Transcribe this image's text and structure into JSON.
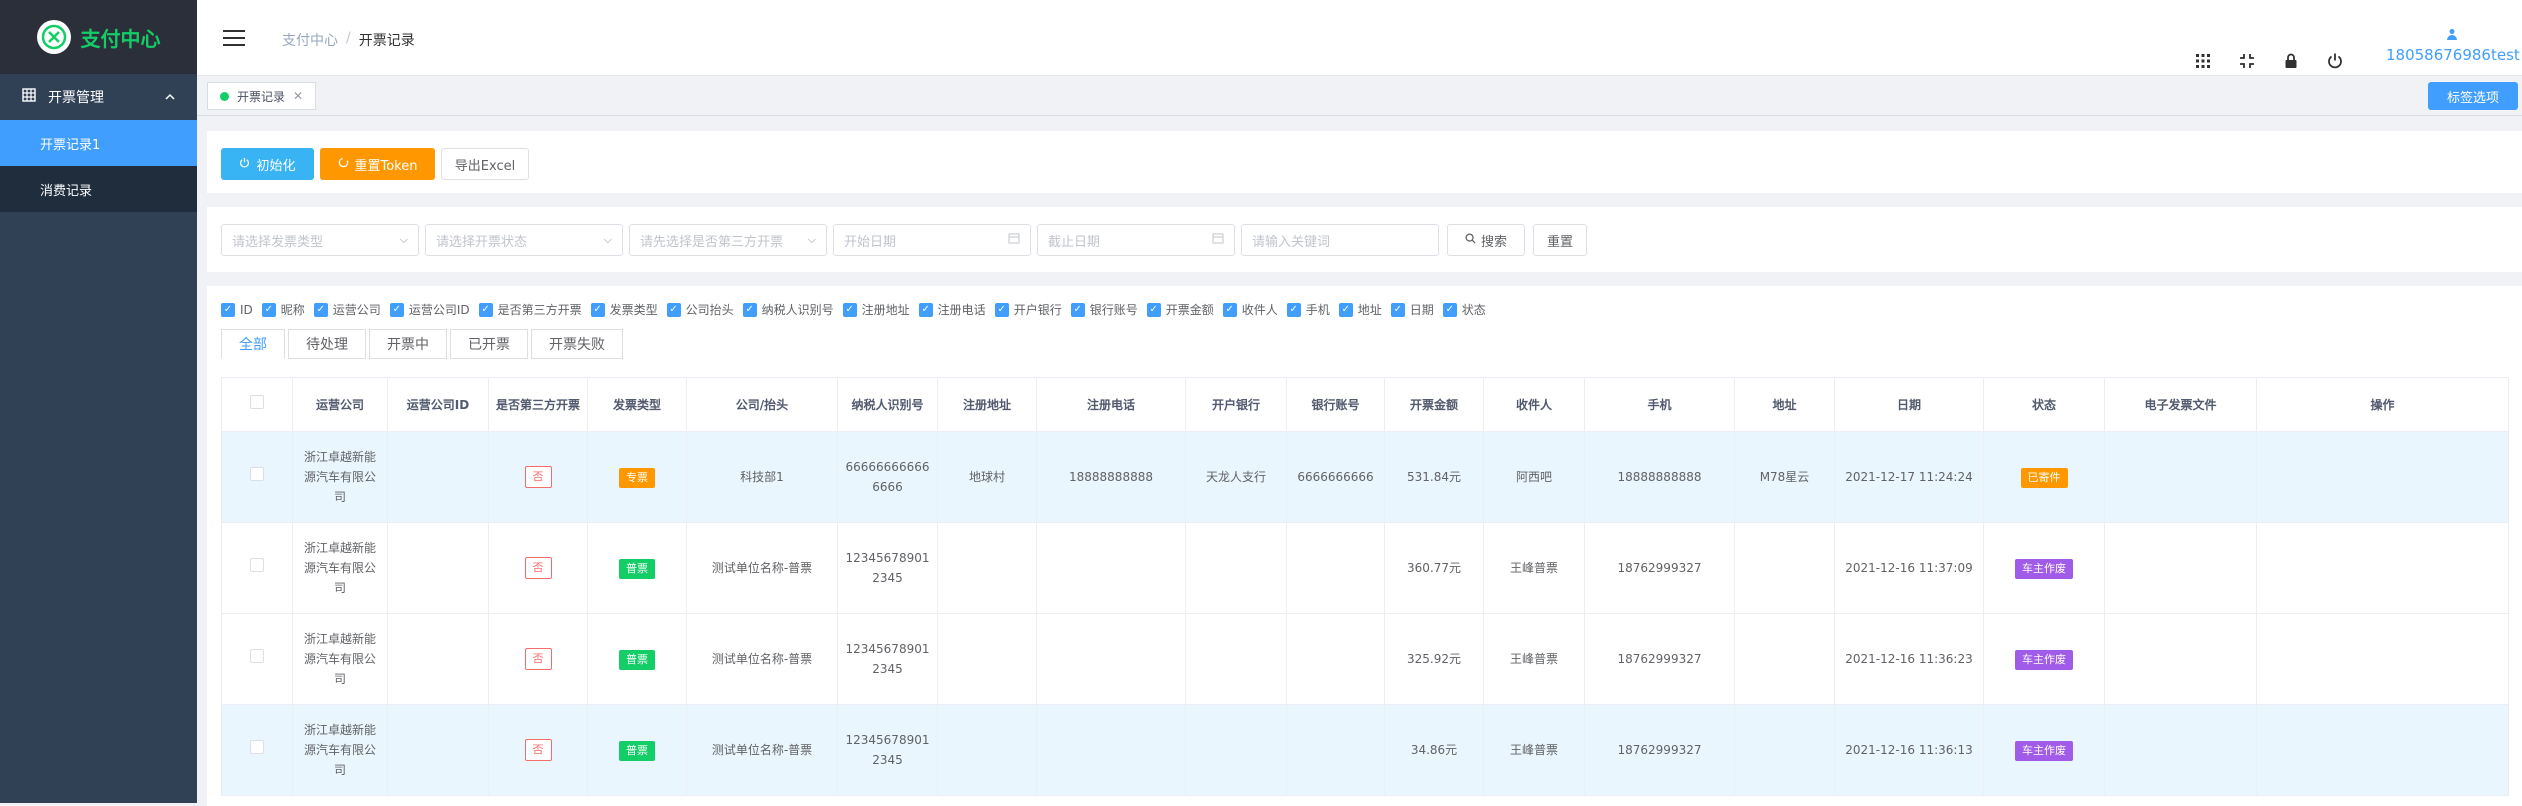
{
  "sidebar": {
    "logo_text": "支付中心",
    "group_label": "开票管理",
    "items": [
      {
        "label": "开票记录1",
        "active": true
      },
      {
        "label": "消费记录",
        "active": false
      }
    ]
  },
  "navbar": {
    "breadcrumb": [
      "支付中心",
      "开票记录"
    ],
    "breadcrumb_sep": "/",
    "username": "18058676986test"
  },
  "tags": {
    "active_tag": "开票记录",
    "tag_options_label": "标签选项"
  },
  "actions": {
    "init_label": "初始化",
    "reset_token_label": "重置Token",
    "export_label": "导出Excel"
  },
  "filters": {
    "invoice_type_placeholder": "请选择发票类型",
    "status_placeholder": "请选择开票状态",
    "third_party_placeholder": "请先选择是否第三方开票",
    "start_date_placeholder": "开始日期",
    "end_date_placeholder": "截止日期",
    "keyword_placeholder": "请输入关键词",
    "search_label": "搜索",
    "reset_label": "重置"
  },
  "column_toggles": [
    "ID",
    "昵称",
    "运营公司",
    "运营公司ID",
    "是否第三方开票",
    "发票类型",
    "公司抬头",
    "纳税人识别号",
    "注册地址",
    "注册电话",
    "开户银行",
    "银行账号",
    "开票金额",
    "收件人",
    "手机",
    "地址",
    "日期",
    "状态"
  ],
  "tabs": [
    "全部",
    "待处理",
    "开票中",
    "已开票",
    "开票失败"
  ],
  "table": {
    "headers": [
      "运营公司",
      "运营公司ID",
      "是否第三方开票",
      "发票类型",
      "公司/抬头",
      "纳税人识别号",
      "注册地址",
      "注册电话",
      "开户银行",
      "银行账号",
      "开票金额",
      "收件人",
      "手机",
      "地址",
      "日期",
      "状态",
      "电子发票文件",
      "操作"
    ],
    "rows": [
      {
        "company": "浙江卓越新能源汽车有限公司",
        "company_id": "",
        "third_party": "否",
        "type": "专票",
        "title": "科技部1",
        "tax_id": "666666666666666",
        "address": "地球村",
        "phone": "18888888888",
        "bank": "天龙人支行",
        "account": "6666666666",
        "amount": "531.84元",
        "recipient": "阿西吧",
        "mobile": "18888888888",
        "addr": "M78星云",
        "date": "2021-12-17 11:24:24",
        "status": "已寄件",
        "status_kind": "sent",
        "highlight": true
      },
      {
        "company": "浙江卓越新能源汽车有限公司",
        "company_id": "",
        "third_party": "否",
        "type": "普票",
        "title": "测试单位名称-普票",
        "tax_id": "123456789012345",
        "address": "",
        "phone": "",
        "bank": "",
        "account": "",
        "amount": "360.77元",
        "recipient": "王峰普票",
        "mobile": "18762999327",
        "addr": "",
        "date": "2021-12-16 11:37:09",
        "status": "车主作废",
        "status_kind": "void",
        "highlight": false
      },
      {
        "company": "浙江卓越新能源汽车有限公司",
        "company_id": "",
        "third_party": "否",
        "type": "普票",
        "title": "测试单位名称-普票",
        "tax_id": "123456789012345",
        "address": "",
        "phone": "",
        "bank": "",
        "account": "",
        "amount": "325.92元",
        "recipient": "王峰普票",
        "mobile": "18762999327",
        "addr": "",
        "date": "2021-12-16 11:36:23",
        "status": "车主作废",
        "status_kind": "void",
        "highlight": false
      },
      {
        "company": "浙江卓越新能源汽车有限公司",
        "company_id": "",
        "third_party": "否",
        "type": "普票",
        "title": "测试单位名称-普票",
        "tax_id": "123456789012345",
        "address": "",
        "phone": "",
        "bank": "",
        "account": "",
        "amount": "34.86元",
        "recipient": "王峰普票",
        "mobile": "18762999327",
        "addr": "",
        "date": "2021-12-16 11:36:13",
        "status": "车主作废",
        "status_kind": "void",
        "highlight": true
      }
    ]
  },
  "colors": {
    "accent": "#409eff",
    "sidebar": "#304156",
    "logo": "#13ce66",
    "warn": "#ff9800",
    "void": "#a05ce8"
  }
}
